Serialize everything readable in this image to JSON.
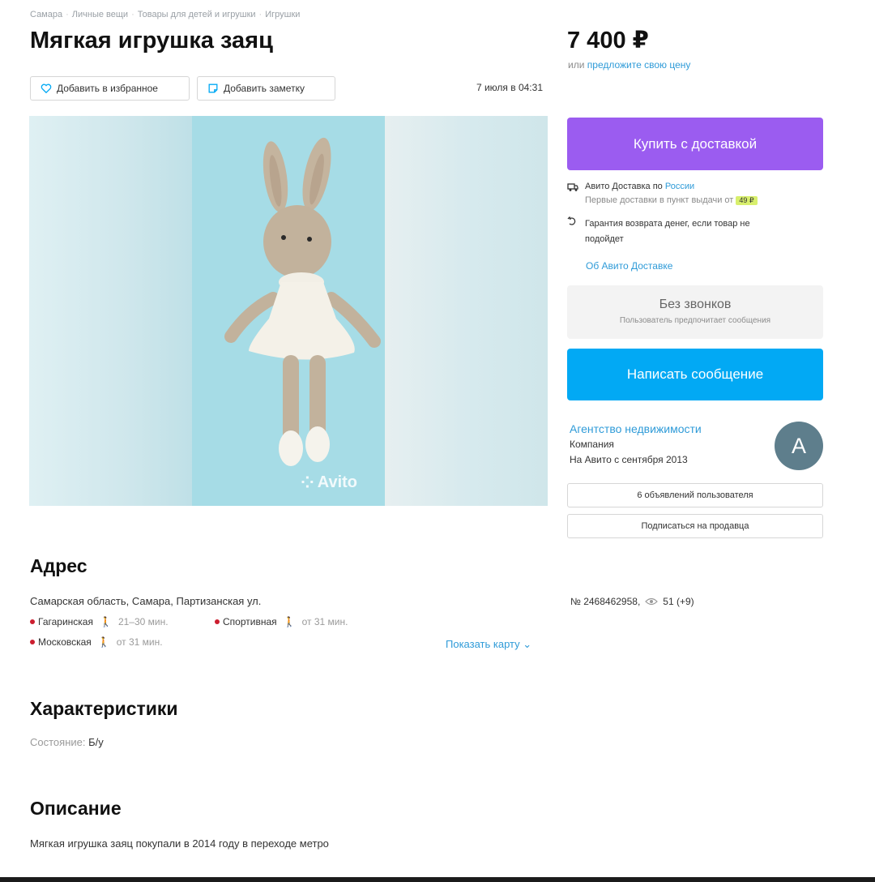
{
  "breadcrumb": [
    "Самара",
    "Личные вещи",
    "Товары для детей и игрушки",
    "Игрушки"
  ],
  "title": "Мягкая игрушка заяц",
  "price": {
    "value": "7 400 ₽",
    "offer_prefix": "или",
    "offer_link": "предложите свою цену"
  },
  "actions": {
    "favorite_label": "Добавить в избранное",
    "note_label": "Добавить заметку",
    "date": "7 июля в 04:31"
  },
  "gallery": {
    "watermark": "Avito"
  },
  "buy_label": "Купить с доставкой",
  "delivery": {
    "title": "Авито Доставка",
    "region_prefix": "по",
    "region_link": "России",
    "first_delivery": "Первые доставки в пункт выдачи от",
    "first_price": "49 ₽",
    "guarantee": "Гарантия возврата денег, если товар не подойдет",
    "about_link": "Об Авито Доставке"
  },
  "no_calls": {
    "title": "Без звонков",
    "subtitle": "Пользователь предпочитает сообщения"
  },
  "message_label": "Написать сообщение",
  "seller": {
    "name": "Агентство недвижимости",
    "type": "Компания",
    "since": "На Авито с сентября 2013",
    "avatar_letter": "А",
    "ads_label": "6 объявлений пользователя",
    "subscribe_label": "Подписаться на продавца"
  },
  "address": {
    "heading": "Адрес",
    "line": "Самарская область, Самара, Партизанская ул.",
    "metro": [
      {
        "name": "Гагаринская",
        "time": "21–30 мин."
      },
      {
        "name": "Спортивная",
        "time": "от 31 мин."
      },
      {
        "name": "Московская",
        "time": "от 31 мин."
      }
    ],
    "show_map": "Показать карту"
  },
  "item_meta": {
    "number": "№ 2468462958,",
    "views": "51 (+9)"
  },
  "characteristics": {
    "heading": "Характеристики",
    "condition_label": "Состояние:",
    "condition_value": "Б/у"
  },
  "description": {
    "heading": "Описание",
    "text": "Мягкая игрушка заяц покупали в 2014 году в переходе метро"
  },
  "colors": {
    "buy": "#9b5cf0",
    "message": "#02a9f4",
    "link": "#2f9bd8",
    "metro": "#cc1e2f"
  }
}
